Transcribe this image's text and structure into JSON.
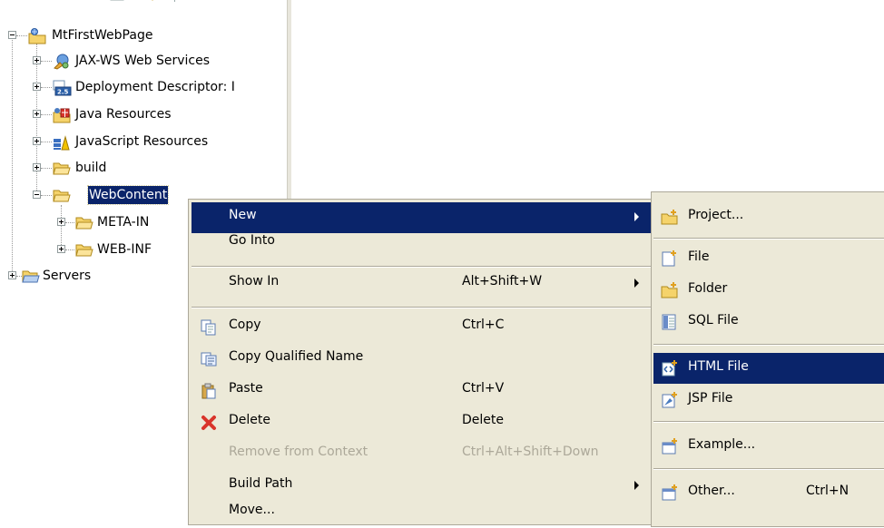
{
  "tree": {
    "items": [
      {
        "label": "MtFirstWebPage",
        "icon": "web-project-icon",
        "expander": "minus"
      },
      {
        "label": "JAX-WS Web Services",
        "icon": "web-services-icon",
        "expander": "plus"
      },
      {
        "label": "Deployment Descriptor: I",
        "icon": "deployment-descriptor-icon",
        "expander": "plus"
      },
      {
        "label": "Java Resources",
        "icon": "java-resources-icon",
        "expander": "plus"
      },
      {
        "label": "JavaScript Resources",
        "icon": "javascript-resources-icon",
        "expander": "plus"
      },
      {
        "label": "build",
        "icon": "folder-icon",
        "expander": "plus"
      },
      {
        "label": "WebContent",
        "icon": "folder-icon",
        "expander": "minus",
        "selected": true
      },
      {
        "label": "META-IN",
        "icon": "folder-icon",
        "expander": "plus"
      },
      {
        "label": "WEB-INF",
        "icon": "folder-icon",
        "expander": "plus"
      },
      {
        "label": "Servers",
        "icon": "folder-icon",
        "expander": "plus"
      }
    ],
    "badge": "2.5"
  },
  "context_menu": {
    "items": [
      {
        "label": "New",
        "shortcut": "",
        "submenu": true,
        "highlighted": true
      },
      {
        "label": "Go Into",
        "shortcut": ""
      },
      {
        "label": "Show In",
        "shortcut": "Alt+Shift+W",
        "submenu": true
      },
      {
        "label": "Copy",
        "shortcut": "Ctrl+C",
        "icon": "copy-icon"
      },
      {
        "label": "Copy Qualified Name",
        "shortcut": "",
        "icon": "copy-qualified-name-icon"
      },
      {
        "label": "Paste",
        "shortcut": "Ctrl+V",
        "icon": "paste-icon"
      },
      {
        "label": "Delete",
        "shortcut": "Delete",
        "icon": "delete-icon"
      },
      {
        "label": "Remove from Context",
        "shortcut": "Ctrl+Alt+Shift+Down",
        "disabled": true
      },
      {
        "label": "Build Path",
        "shortcut": "",
        "submenu": true
      },
      {
        "label": "Move...",
        "shortcut": ""
      }
    ]
  },
  "submenu": {
    "items": [
      {
        "label": "Project...",
        "icon": "new-project-icon"
      },
      {
        "label": "File",
        "icon": "new-file-icon"
      },
      {
        "label": "Folder",
        "icon": "new-folder-icon"
      },
      {
        "label": "SQL File",
        "icon": "sql-file-icon"
      },
      {
        "label": "HTML File",
        "icon": "html-file-icon",
        "highlighted": true
      },
      {
        "label": "JSP File",
        "icon": "jsp-file-icon"
      },
      {
        "label": "Example...",
        "icon": "new-example-icon"
      },
      {
        "label": "Other...",
        "shortcut": "Ctrl+N",
        "icon": "new-other-icon"
      }
    ]
  },
  "colors": {
    "selection": "#0a246a",
    "menu_background": "#ece9d8",
    "folder": "#f5d36b",
    "delete": "#d9342b"
  }
}
